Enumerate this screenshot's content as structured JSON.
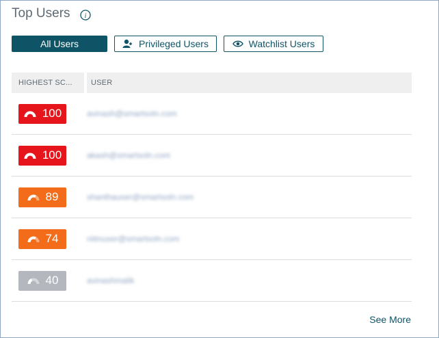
{
  "title": "Top Users",
  "tabs": [
    {
      "label": "All Users",
      "active": true
    },
    {
      "label": "Privileged Users",
      "active": false
    },
    {
      "label": "Watchlist Users",
      "active": false
    }
  ],
  "table": {
    "headers": [
      "HIGHEST SC...",
      "USER"
    ],
    "rows": [
      {
        "score": "100",
        "user": "avinash@smartsoln.com",
        "color": "#e5151b"
      },
      {
        "score": "100",
        "user": "akash@smartsoln.com",
        "color": "#e5151b"
      },
      {
        "score": "89",
        "user": "shanthauser@smartsoln.com",
        "color": "#f26c1a"
      },
      {
        "score": "74",
        "user": "nitinuser@smartsoln.com",
        "color": "#f26c1a"
      },
      {
        "score": "40",
        "user": "avinashmalik",
        "color": "#b4b7bd"
      }
    ]
  },
  "footer": {
    "see_more": "See More"
  },
  "colors": {
    "accent": "#0f5466",
    "critical": "#e5151b",
    "high": "#f26c1a",
    "low": "#b4b7bd"
  }
}
